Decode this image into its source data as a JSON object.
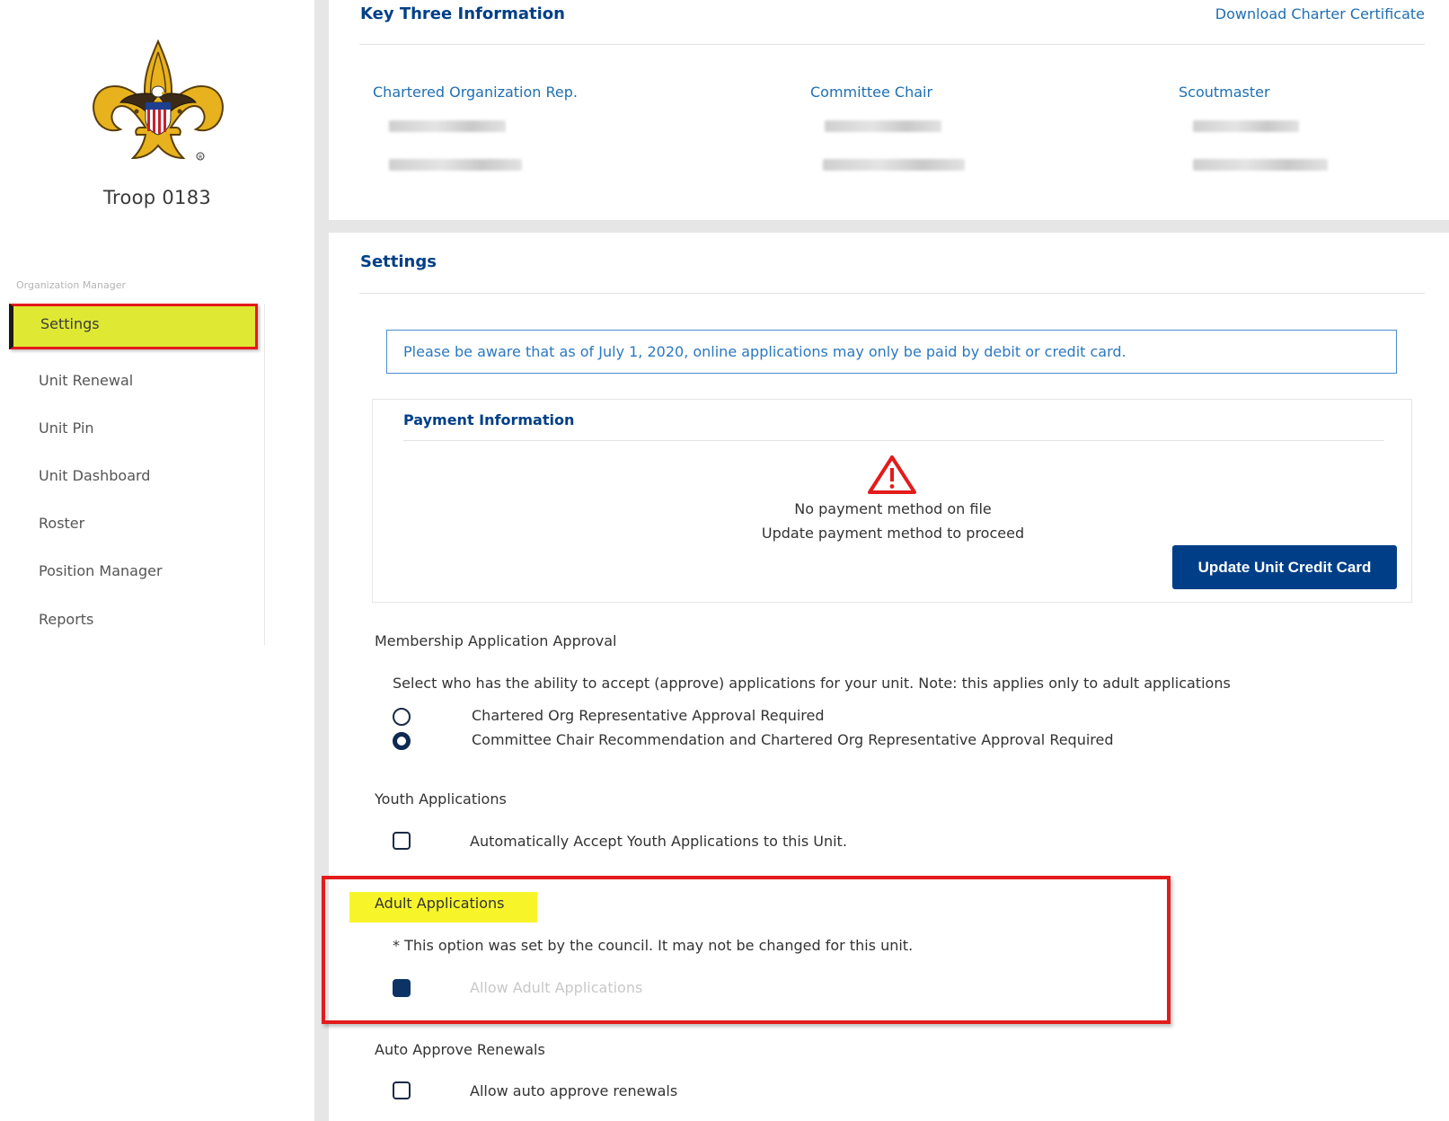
{
  "sidebar": {
    "troop_name": "Troop 0183",
    "section_label": "Organization Manager",
    "items": [
      {
        "label": "Settings",
        "active": true
      },
      {
        "label": "Unit Renewal"
      },
      {
        "label": "Unit Pin"
      },
      {
        "label": "Unit Dashboard"
      },
      {
        "label": "Roster"
      },
      {
        "label": "Position Manager"
      },
      {
        "label": "Reports"
      }
    ]
  },
  "key_three": {
    "title": "Key Three Information",
    "download_link": "Download Charter Certificate",
    "columns": [
      {
        "label": "Chartered Organization Rep."
      },
      {
        "label": "Committee Chair"
      },
      {
        "label": "Scoutmaster"
      }
    ]
  },
  "settings": {
    "title": "Settings",
    "notice": "Please be aware that as of July 1, 2020, online applications may only be paid by debit or credit card.",
    "payment": {
      "title": "Payment Information",
      "message_line1": "No payment method on file",
      "message_line2": "Update payment method to proceed",
      "button_label": "Update Unit Credit Card"
    },
    "membership": {
      "title": "Membership Application Approval",
      "description": "Select who has the ability to accept (approve) applications for your unit. Note: this applies only to adult applications",
      "options": [
        {
          "label": "Chartered Org Representative Approval Required",
          "selected": false
        },
        {
          "label": "Committee Chair Recommendation and Chartered Org Representative Approval Required",
          "selected": true
        }
      ]
    },
    "youth": {
      "title": "Youth Applications",
      "checkbox_label": "Automatically Accept Youth Applications to this Unit.",
      "checked": false
    },
    "adult": {
      "title": "Adult Applications",
      "note": "* This option was set by the council. It may not be changed for this unit.",
      "checkbox_label": "Allow Adult Applications",
      "checked": true,
      "disabled": true
    },
    "auto_approve": {
      "title": "Auto Approve Renewals",
      "checkbox_label": "Allow auto approve renewals",
      "checked": false
    }
  },
  "colors": {
    "brand_navy": "#003f87",
    "link_blue": "#1f6fb2",
    "highlight_yellow": "#f7f52a",
    "annotation_red": "#e31b1b",
    "warning_red": "#e31b1b"
  }
}
